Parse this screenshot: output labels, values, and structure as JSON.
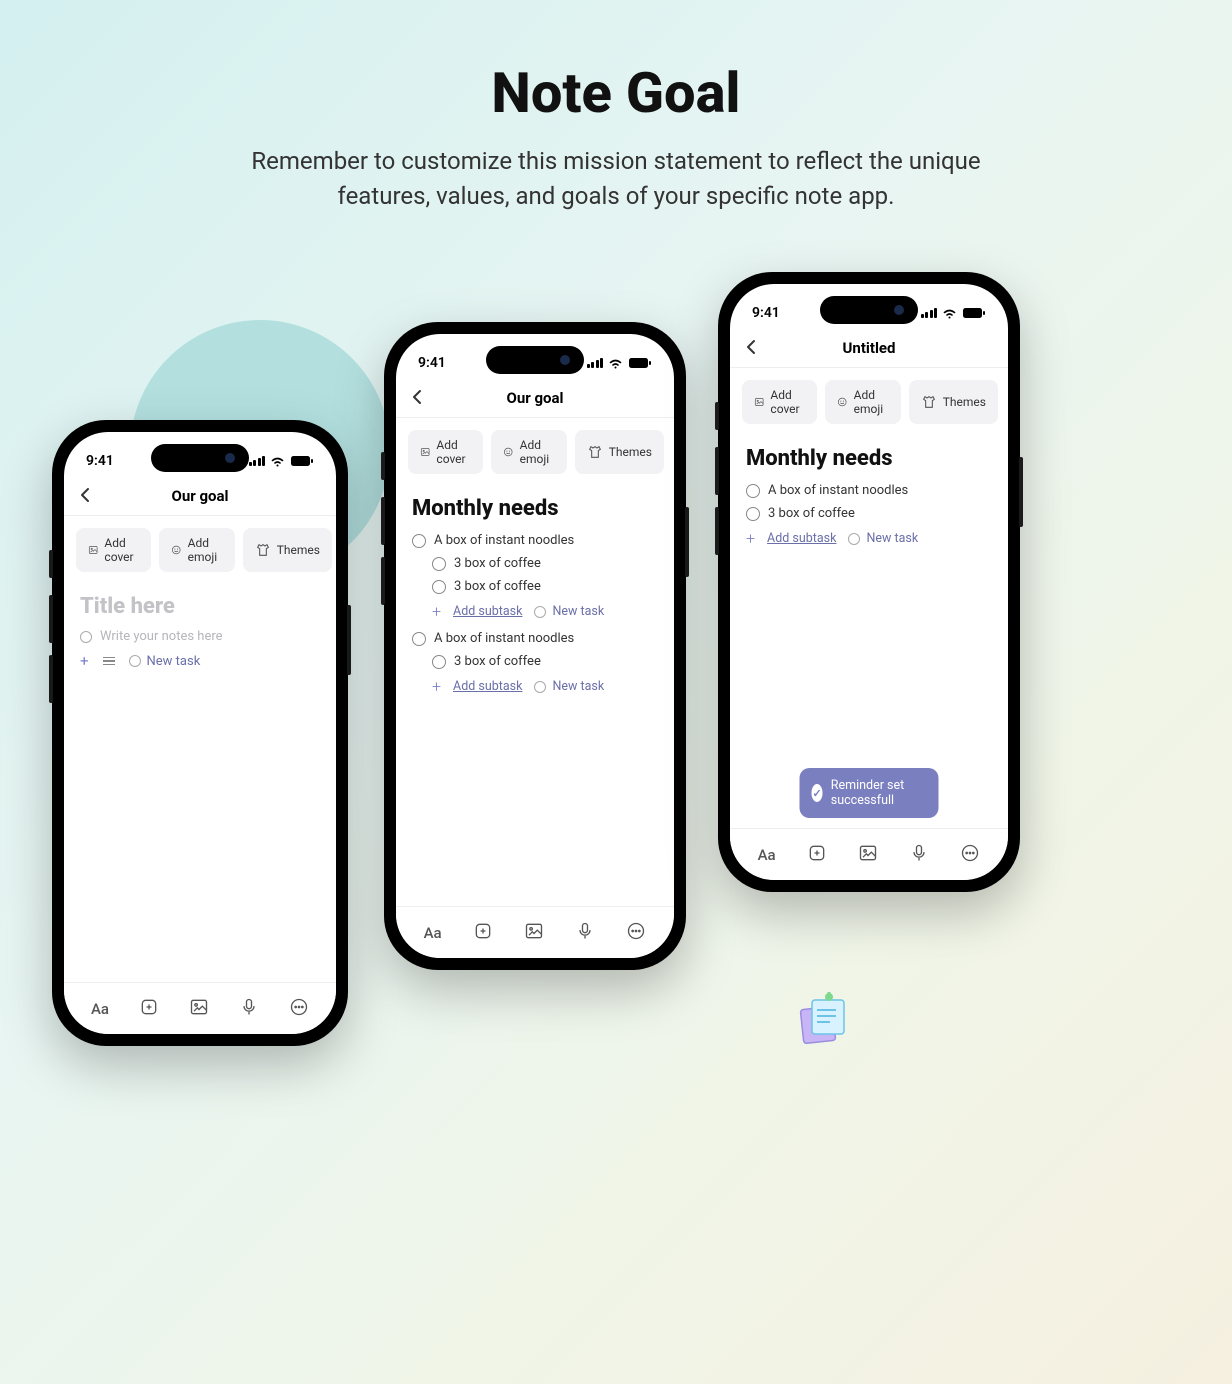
{
  "hero": {
    "title": "Note Goal",
    "subtitle": "Remember to customize this mission statement to reflect the unique features, values, and goals of your specific note app."
  },
  "status": {
    "time": "9:41"
  },
  "chips": {
    "cover": "Add cover",
    "emoji": "Add emoji",
    "themes": "Themes"
  },
  "actions": {
    "add_subtask": "Add subtask",
    "new_task": "New task"
  },
  "phone1": {
    "nav_title": "Our goal",
    "title_placeholder": "Title here",
    "notes_placeholder": "Write your notes here"
  },
  "phone2": {
    "nav_title": "Our goal",
    "note_title": "Monthly needs",
    "items": [
      {
        "label": "A box of instant noodles",
        "subs": [
          "3 box of coffee",
          "3 box of coffee"
        ]
      },
      {
        "label": "A box of instant noodles",
        "subs": [
          "3 box of coffee"
        ]
      }
    ]
  },
  "phone3": {
    "nav_title": "Untitled",
    "note_title": "Monthly needs",
    "items": [
      "A box of instant noodles",
      "3 box of coffee"
    ],
    "toast": "Reminder set successfull"
  }
}
